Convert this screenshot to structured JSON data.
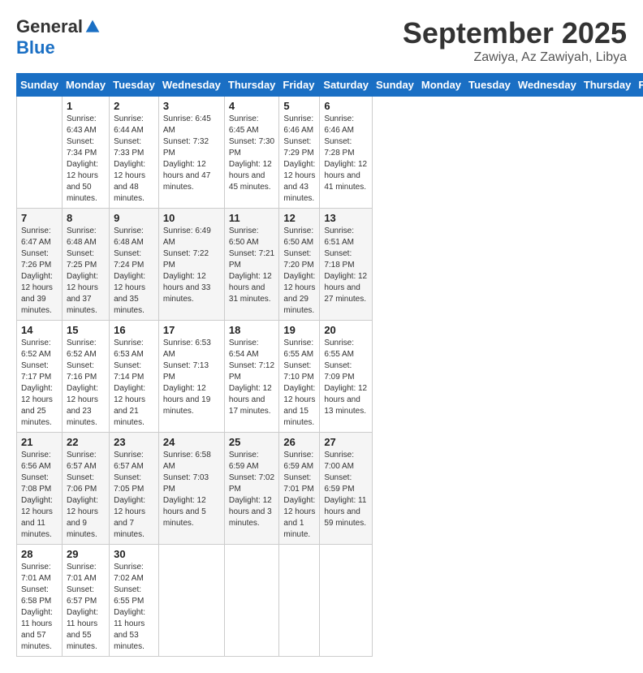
{
  "header": {
    "logo_general": "General",
    "logo_blue": "Blue",
    "month_title": "September 2025",
    "location": "Zawiya, Az Zawiyah, Libya"
  },
  "days_of_week": [
    "Sunday",
    "Monday",
    "Tuesday",
    "Wednesday",
    "Thursday",
    "Friday",
    "Saturday"
  ],
  "weeks": [
    [
      {
        "day": "",
        "sunrise": "",
        "sunset": "",
        "daylight": ""
      },
      {
        "day": "1",
        "sunrise": "Sunrise: 6:43 AM",
        "sunset": "Sunset: 7:34 PM",
        "daylight": "Daylight: 12 hours and 50 minutes."
      },
      {
        "day": "2",
        "sunrise": "Sunrise: 6:44 AM",
        "sunset": "Sunset: 7:33 PM",
        "daylight": "Daylight: 12 hours and 48 minutes."
      },
      {
        "day": "3",
        "sunrise": "Sunrise: 6:45 AM",
        "sunset": "Sunset: 7:32 PM",
        "daylight": "Daylight: 12 hours and 47 minutes."
      },
      {
        "day": "4",
        "sunrise": "Sunrise: 6:45 AM",
        "sunset": "Sunset: 7:30 PM",
        "daylight": "Daylight: 12 hours and 45 minutes."
      },
      {
        "day": "5",
        "sunrise": "Sunrise: 6:46 AM",
        "sunset": "Sunset: 7:29 PM",
        "daylight": "Daylight: 12 hours and 43 minutes."
      },
      {
        "day": "6",
        "sunrise": "Sunrise: 6:46 AM",
        "sunset": "Sunset: 7:28 PM",
        "daylight": "Daylight: 12 hours and 41 minutes."
      }
    ],
    [
      {
        "day": "7",
        "sunrise": "Sunrise: 6:47 AM",
        "sunset": "Sunset: 7:26 PM",
        "daylight": "Daylight: 12 hours and 39 minutes."
      },
      {
        "day": "8",
        "sunrise": "Sunrise: 6:48 AM",
        "sunset": "Sunset: 7:25 PM",
        "daylight": "Daylight: 12 hours and 37 minutes."
      },
      {
        "day": "9",
        "sunrise": "Sunrise: 6:48 AM",
        "sunset": "Sunset: 7:24 PM",
        "daylight": "Daylight: 12 hours and 35 minutes."
      },
      {
        "day": "10",
        "sunrise": "Sunrise: 6:49 AM",
        "sunset": "Sunset: 7:22 PM",
        "daylight": "Daylight: 12 hours and 33 minutes."
      },
      {
        "day": "11",
        "sunrise": "Sunrise: 6:50 AM",
        "sunset": "Sunset: 7:21 PM",
        "daylight": "Daylight: 12 hours and 31 minutes."
      },
      {
        "day": "12",
        "sunrise": "Sunrise: 6:50 AM",
        "sunset": "Sunset: 7:20 PM",
        "daylight": "Daylight: 12 hours and 29 minutes."
      },
      {
        "day": "13",
        "sunrise": "Sunrise: 6:51 AM",
        "sunset": "Sunset: 7:18 PM",
        "daylight": "Daylight: 12 hours and 27 minutes."
      }
    ],
    [
      {
        "day": "14",
        "sunrise": "Sunrise: 6:52 AM",
        "sunset": "Sunset: 7:17 PM",
        "daylight": "Daylight: 12 hours and 25 minutes."
      },
      {
        "day": "15",
        "sunrise": "Sunrise: 6:52 AM",
        "sunset": "Sunset: 7:16 PM",
        "daylight": "Daylight: 12 hours and 23 minutes."
      },
      {
        "day": "16",
        "sunrise": "Sunrise: 6:53 AM",
        "sunset": "Sunset: 7:14 PM",
        "daylight": "Daylight: 12 hours and 21 minutes."
      },
      {
        "day": "17",
        "sunrise": "Sunrise: 6:53 AM",
        "sunset": "Sunset: 7:13 PM",
        "daylight": "Daylight: 12 hours and 19 minutes."
      },
      {
        "day": "18",
        "sunrise": "Sunrise: 6:54 AM",
        "sunset": "Sunset: 7:12 PM",
        "daylight": "Daylight: 12 hours and 17 minutes."
      },
      {
        "day": "19",
        "sunrise": "Sunrise: 6:55 AM",
        "sunset": "Sunset: 7:10 PM",
        "daylight": "Daylight: 12 hours and 15 minutes."
      },
      {
        "day": "20",
        "sunrise": "Sunrise: 6:55 AM",
        "sunset": "Sunset: 7:09 PM",
        "daylight": "Daylight: 12 hours and 13 minutes."
      }
    ],
    [
      {
        "day": "21",
        "sunrise": "Sunrise: 6:56 AM",
        "sunset": "Sunset: 7:08 PM",
        "daylight": "Daylight: 12 hours and 11 minutes."
      },
      {
        "day": "22",
        "sunrise": "Sunrise: 6:57 AM",
        "sunset": "Sunset: 7:06 PM",
        "daylight": "Daylight: 12 hours and 9 minutes."
      },
      {
        "day": "23",
        "sunrise": "Sunrise: 6:57 AM",
        "sunset": "Sunset: 7:05 PM",
        "daylight": "Daylight: 12 hours and 7 minutes."
      },
      {
        "day": "24",
        "sunrise": "Sunrise: 6:58 AM",
        "sunset": "Sunset: 7:03 PM",
        "daylight": "Daylight: 12 hours and 5 minutes."
      },
      {
        "day": "25",
        "sunrise": "Sunrise: 6:59 AM",
        "sunset": "Sunset: 7:02 PM",
        "daylight": "Daylight: 12 hours and 3 minutes."
      },
      {
        "day": "26",
        "sunrise": "Sunrise: 6:59 AM",
        "sunset": "Sunset: 7:01 PM",
        "daylight": "Daylight: 12 hours and 1 minute."
      },
      {
        "day": "27",
        "sunrise": "Sunrise: 7:00 AM",
        "sunset": "Sunset: 6:59 PM",
        "daylight": "Daylight: 11 hours and 59 minutes."
      }
    ],
    [
      {
        "day": "28",
        "sunrise": "Sunrise: 7:01 AM",
        "sunset": "Sunset: 6:58 PM",
        "daylight": "Daylight: 11 hours and 57 minutes."
      },
      {
        "day": "29",
        "sunrise": "Sunrise: 7:01 AM",
        "sunset": "Sunset: 6:57 PM",
        "daylight": "Daylight: 11 hours and 55 minutes."
      },
      {
        "day": "30",
        "sunrise": "Sunrise: 7:02 AM",
        "sunset": "Sunset: 6:55 PM",
        "daylight": "Daylight: 11 hours and 53 minutes."
      },
      {
        "day": "",
        "sunrise": "",
        "sunset": "",
        "daylight": ""
      },
      {
        "day": "",
        "sunrise": "",
        "sunset": "",
        "daylight": ""
      },
      {
        "day": "",
        "sunrise": "",
        "sunset": "",
        "daylight": ""
      },
      {
        "day": "",
        "sunrise": "",
        "sunset": "",
        "daylight": ""
      }
    ]
  ]
}
